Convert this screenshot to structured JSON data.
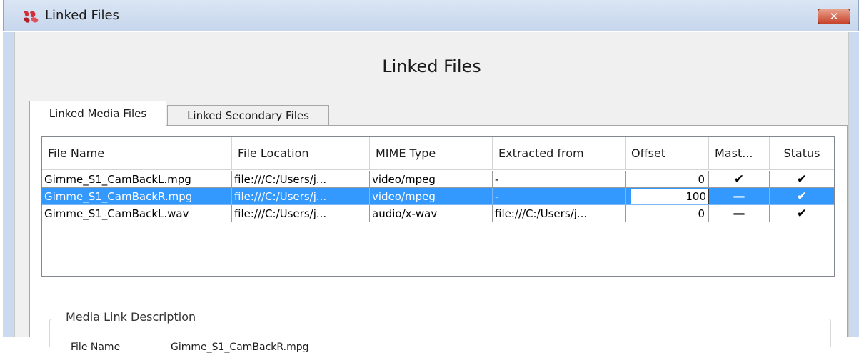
{
  "window": {
    "title": "Linked Files",
    "close_label": "✕",
    "heading": "Linked Files"
  },
  "tabs": [
    {
      "label": "Linked Media Files",
      "active": true
    },
    {
      "label": "Linked Secondary Files",
      "active": false
    }
  ],
  "table": {
    "columns": [
      "File Name",
      "File Location",
      "MIME Type",
      "Extracted from",
      "Offset",
      "Mast...",
      "Status"
    ],
    "rows": [
      {
        "file_name": "Gimme_S1_CamBackL.mpg",
        "location": "file:///C:/Users/j...",
        "mime": "video/mpeg",
        "extracted": "-",
        "offset": "0",
        "master": "✔",
        "status": "✔",
        "selected": false
      },
      {
        "file_name": "Gimme_S1_CamBackR.mpg",
        "location": "file:///C:/Users/j...",
        "mime": "video/mpeg",
        "extracted": "-",
        "offset": "100",
        "master": "—",
        "status": "✔",
        "selected": true
      },
      {
        "file_name": "Gimme_S1_CamBackL.wav",
        "location": "file:///C:/Users/j...",
        "mime": "audio/x-wav",
        "extracted": "file:///C:/Users/j...",
        "offset": "0",
        "master": "—",
        "status": "✔",
        "selected": false
      }
    ]
  },
  "description": {
    "legend": "Media Link Description",
    "file_name_label": "File Name",
    "file_name_value": "Gimme_S1_CamBackR.mpg"
  },
  "colors": {
    "selection": "#3399ff",
    "titlebar": "#c6d6ec",
    "close_button": "#c7432b"
  }
}
